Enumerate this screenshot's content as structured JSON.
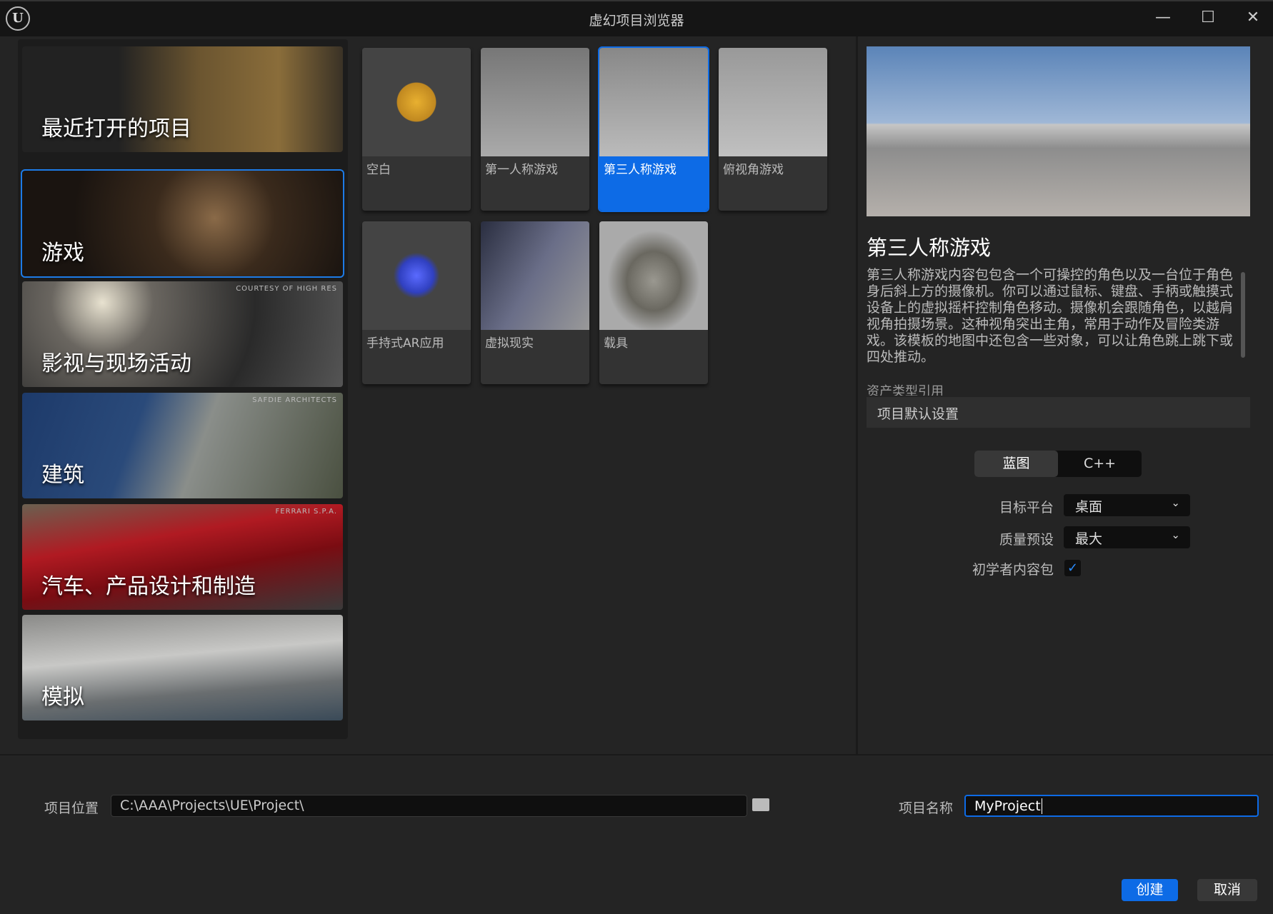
{
  "window": {
    "title": "虚幻项目浏览器",
    "logo": "U",
    "minimize": "—",
    "maximize": "☐",
    "close": "✕"
  },
  "categories": [
    {
      "label": "最近打开的项目",
      "credit": ""
    },
    {
      "label": "游戏",
      "credit": "",
      "selected": true
    },
    {
      "label": "影视与现场活动",
      "credit": "COURTESY OF HIGH RES"
    },
    {
      "label": "建筑",
      "credit": "SAFDIE ARCHITECTS"
    },
    {
      "label": "汽车、产品设计和制造",
      "credit": "FERRARI S.P.A."
    },
    {
      "label": "模拟",
      "credit": ""
    }
  ],
  "templates": [
    {
      "label": "空白"
    },
    {
      "label": "第一人称游戏"
    },
    {
      "label": "第三人称游戏",
      "selected": true
    },
    {
      "label": "俯视角游戏"
    },
    {
      "label": "手持式AR应用"
    },
    {
      "label": "虚拟现实"
    },
    {
      "label": "载具"
    }
  ],
  "details": {
    "title": "第三人称游戏",
    "description": "第三人称游戏内容包包含一个可操控的角色以及一台位于角色身后斜上方的摄像机。你可以通过鼠标、键盘、手柄或触摸式设备上的虚拟摇杆控制角色移动。摄像机会跟随角色，以越肩视角拍摄场景。这种视角突出主角，常用于动作及冒险类游戏。该模板的地图中还包含一些对象，可以让角色跳上跳下或四处推动。",
    "asset_ref_label": "资产类型引用",
    "section": "项目默认设置",
    "toggle": {
      "blueprint": "蓝图",
      "cpp": "C++",
      "selected": "蓝图"
    },
    "target_platform": {
      "label": "目标平台",
      "value": "桌面"
    },
    "quality_preset": {
      "label": "质量预设",
      "value": "最大"
    },
    "starter_content": {
      "label": "初学者内容包",
      "checked": true
    }
  },
  "footer": {
    "location_label": "项目位置",
    "location_value": "C:\\AAA\\Projects\\UE\\Project\\",
    "name_label": "项目名称",
    "name_value": "MyProject",
    "create": "创建",
    "cancel": "取消"
  },
  "colors": {
    "accent": "#0d6be6",
    "background": "#242424"
  }
}
